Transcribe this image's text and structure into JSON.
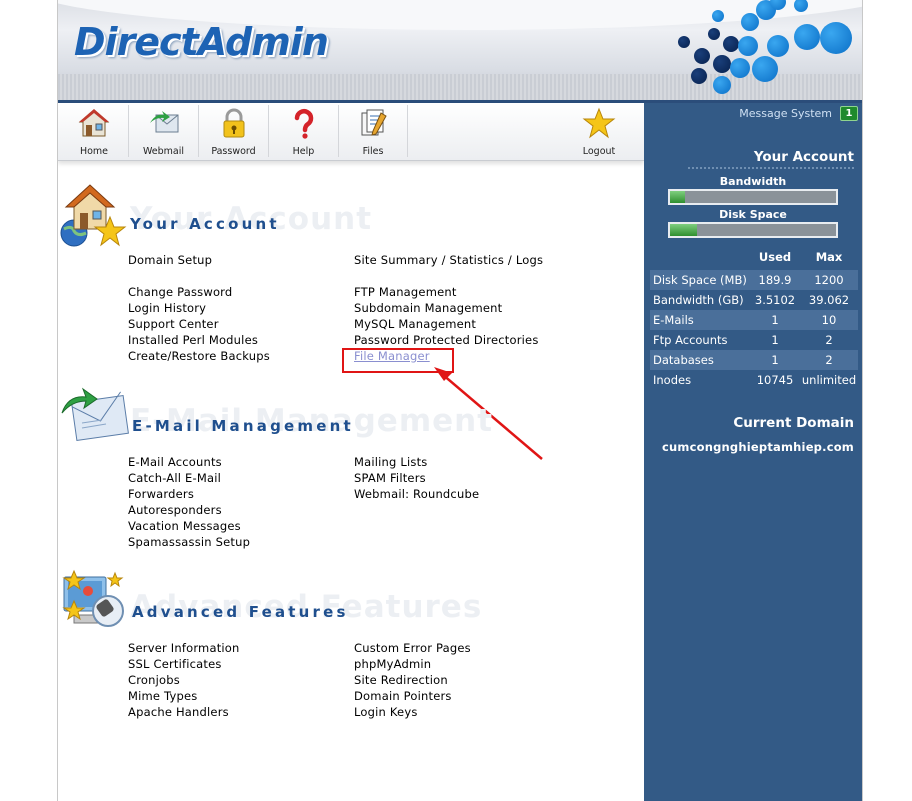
{
  "header": {
    "logo": "DirectAdmin"
  },
  "toolbar": [
    {
      "label": "Home",
      "icon": "house-icon"
    },
    {
      "label": "Webmail",
      "icon": "mail-icon"
    },
    {
      "label": "Password",
      "icon": "lock-icon"
    },
    {
      "label": "Help",
      "icon": "question-icon"
    },
    {
      "label": "Files",
      "icon": "files-icon"
    },
    {
      "label": "Logout",
      "icon": "star-icon"
    }
  ],
  "sidebar": {
    "message_label": "Message System",
    "message_count": "1",
    "account_title": "Your Account",
    "bandwidth_label": "Bandwidth",
    "bandwidth_fill": 0.09,
    "disk_label": "Disk Space",
    "disk_fill": 0.16,
    "stats_headers": {
      "used": "Used",
      "max": "Max"
    },
    "stats": [
      {
        "name": "Disk Space (MB)",
        "used": "189.9",
        "max": "1200"
      },
      {
        "name": "Bandwidth (GB)",
        "used": "3.5102",
        "max": "39.062"
      },
      {
        "name": "E-Mails",
        "used": "1",
        "max": "10"
      },
      {
        "name": "Ftp Accounts",
        "used": "1",
        "max": "2"
      },
      {
        "name": "Databases",
        "used": "1",
        "max": "2"
      },
      {
        "name": "Inodes",
        "used": "10745",
        "max": "unlimited"
      }
    ],
    "domain_title": "Current Domain",
    "domain": "cumcongnghieptamhiep.com"
  },
  "sections": {
    "account": {
      "title": "Your Account",
      "left": [
        "Domain Setup",
        "Change Password",
        "Login History",
        "Support Center",
        "Installed Perl Modules",
        "Create/Restore Backups"
      ],
      "right": [
        "Site Summary / Statistics / Logs",
        "FTP Management",
        "Subdomain Management",
        "MySQL Management",
        "Password Protected Directories",
        "File Manager"
      ]
    },
    "email": {
      "title": "E-Mail Management",
      "left": [
        "E-Mail Accounts",
        "Catch-All E-Mail",
        "Forwarders",
        "Autoresponders",
        "Vacation Messages",
        "Spamassassin Setup"
      ],
      "right": [
        "Mailing Lists",
        "SPAM Filters",
        "Webmail: Roundcube"
      ]
    },
    "advanced": {
      "title": "Advanced Features",
      "left": [
        "Server Information",
        "SSL Certificates",
        "Cronjobs",
        "Mime Types",
        "Apache Handlers"
      ],
      "right": [
        "Custom Error Pages",
        "phpMyAdmin",
        "Site Redirection",
        "Domain Pointers",
        "Login Keys"
      ]
    }
  },
  "colors": {
    "sidebar": "#335a86",
    "title": "#1f4f8e",
    "annotation": "#e01515",
    "brand": "#1d63b4"
  }
}
